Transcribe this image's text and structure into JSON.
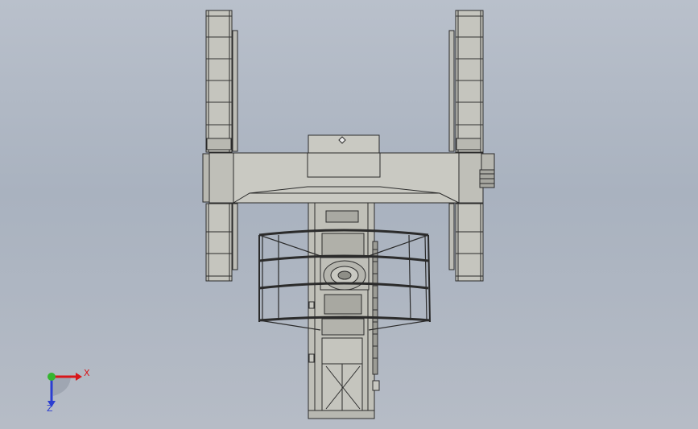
{
  "app": {
    "view": "graphics-area"
  },
  "colors": {
    "background_top": "#b9c0cb",
    "background_bottom": "#a9b2bf",
    "model_line": "#2b2b2b",
    "model_fill": "#c9c9c2",
    "model_fill_dark": "#9a9a93",
    "axis_x": "#d8161a",
    "axis_y": "#35b52f",
    "axis_z": "#2b3ed1"
  },
  "triad": {
    "x_label": "X",
    "z_label": "Z",
    "icons": [
      "triad-x-arrow-icon",
      "triad-y-dot-icon",
      "triad-z-arrow-icon"
    ]
  }
}
